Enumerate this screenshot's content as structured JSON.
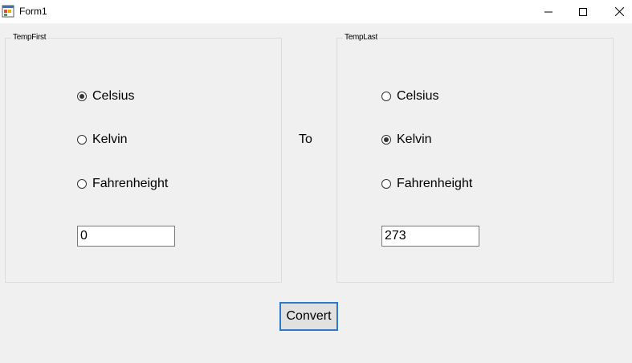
{
  "window": {
    "title": "Form1"
  },
  "group_first": {
    "legend": "TempFirst",
    "options": [
      {
        "label": "Celsius",
        "checked": true
      },
      {
        "label": "Kelvin",
        "checked": false
      },
      {
        "label": "Fahrenheight",
        "checked": false
      }
    ],
    "value": "0"
  },
  "group_last": {
    "legend": "TempLast",
    "options": [
      {
        "label": "Celsius",
        "checked": false
      },
      {
        "label": "Kelvin",
        "checked": true
      },
      {
        "label": "Fahrenheight",
        "checked": false
      }
    ],
    "value": "273"
  },
  "to_label": "To",
  "convert_label": "Convert",
  "colors": {
    "button_border": "#2c7ac6",
    "window_bg": "#f0f0f0"
  }
}
